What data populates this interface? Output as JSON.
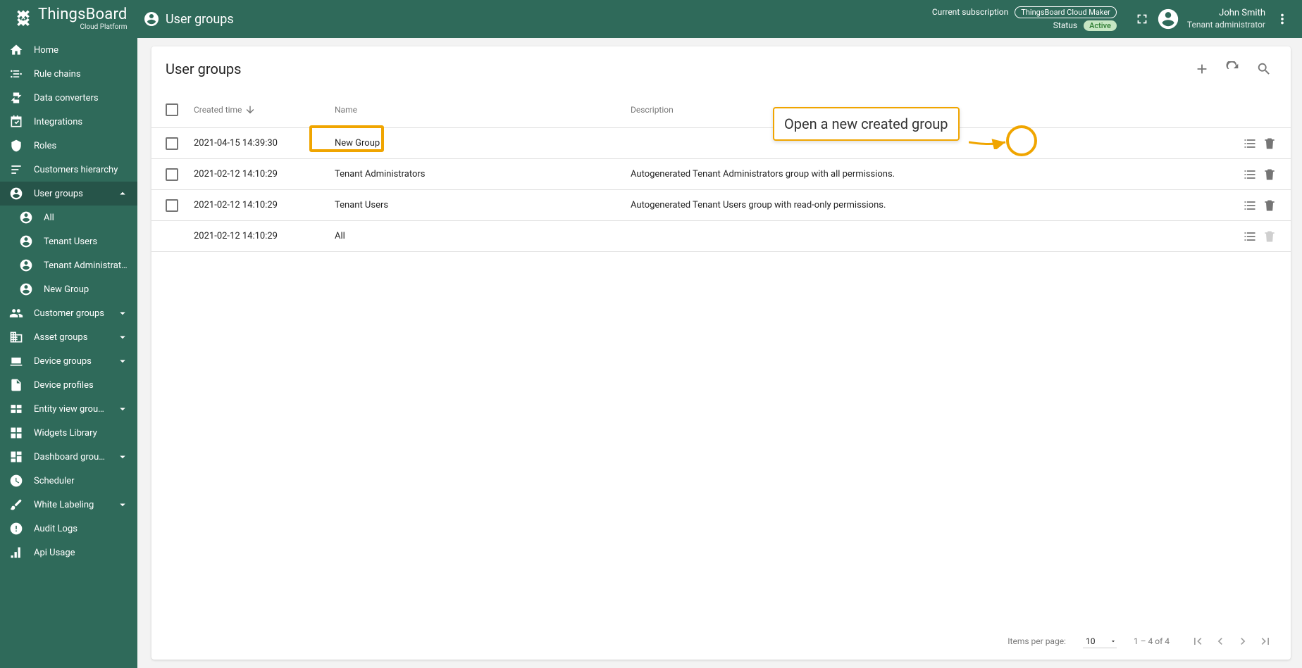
{
  "brand": {
    "name": "ThingsBoard",
    "subtitle": "Cloud Platform"
  },
  "header": {
    "title": "User groups",
    "subscription_label": "Current subscription",
    "subscription_plan": "ThingsBoard Cloud Maker",
    "status_label": "Status",
    "status_value": "Active",
    "user_name": "John Smith",
    "user_role": "Tenant administrator"
  },
  "sidebar": {
    "items": [
      {
        "icon": "home",
        "label": "Home"
      },
      {
        "icon": "rule",
        "label": "Rule chains"
      },
      {
        "icon": "convert",
        "label": "Data converters"
      },
      {
        "icon": "integrations",
        "label": "Integrations"
      },
      {
        "icon": "shield",
        "label": "Roles"
      },
      {
        "icon": "hierarchy",
        "label": "Customers hierarchy"
      },
      {
        "icon": "account",
        "label": "User groups",
        "expanded": true,
        "active": true,
        "children": [
          {
            "icon": "account",
            "label": "All"
          },
          {
            "icon": "account",
            "label": "Tenant Users"
          },
          {
            "icon": "account",
            "label": "Tenant Administrators"
          },
          {
            "icon": "account",
            "label": "New Group"
          }
        ]
      },
      {
        "icon": "people",
        "label": "Customer groups",
        "expandable": true
      },
      {
        "icon": "domain",
        "label": "Asset groups",
        "expandable": true
      },
      {
        "icon": "devices",
        "label": "Device groups",
        "expandable": true
      },
      {
        "icon": "profile",
        "label": "Device profiles"
      },
      {
        "icon": "entity",
        "label": "Entity view groups",
        "expandable": true
      },
      {
        "icon": "widgets",
        "label": "Widgets Library"
      },
      {
        "icon": "dashboard",
        "label": "Dashboard groups",
        "expandable": true
      },
      {
        "icon": "clock",
        "label": "Scheduler"
      },
      {
        "icon": "brush",
        "label": "White Labeling",
        "expandable": true
      },
      {
        "icon": "audit",
        "label": "Audit Logs"
      },
      {
        "icon": "usage",
        "label": "Api Usage"
      }
    ]
  },
  "table": {
    "title": "User groups",
    "columns": {
      "created": "Created time",
      "name": "Name",
      "description": "Description"
    },
    "rows": [
      {
        "created": "2021-04-15 14:39:30",
        "name": "New Group",
        "description": "",
        "checkbox": true,
        "delete": true
      },
      {
        "created": "2021-02-12 14:10:29",
        "name": "Tenant Administrators",
        "description": "Autogenerated Tenant Administrators group with all permissions.",
        "checkbox": true,
        "delete": true
      },
      {
        "created": "2021-02-12 14:10:29",
        "name": "Tenant Users",
        "description": "Autogenerated Tenant Users group with read-only permissions.",
        "checkbox": true,
        "delete": true
      },
      {
        "created": "2021-02-12 14:10:29",
        "name": "All",
        "description": "",
        "checkbox": false,
        "delete": false
      }
    ]
  },
  "pagination": {
    "items_per_page_label": "Items per page:",
    "items_per_page": "10",
    "range": "1 – 4 of 4"
  },
  "annotation": {
    "tooltip": "Open a new created group"
  }
}
